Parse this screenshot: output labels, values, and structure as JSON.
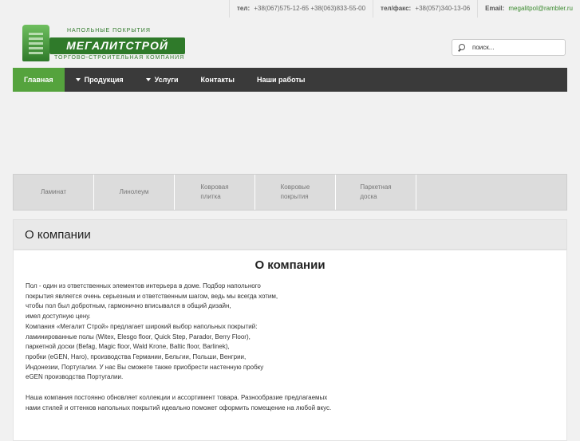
{
  "topbar": {
    "phone_label": "тел:",
    "phone_value": "+38(067)575-12-65 +38(063)833-55-00",
    "fax_label": "тел/факс:",
    "fax_value": "+38(057)340-13-06",
    "email_label": "Email:",
    "email_value": "megalitpol@rambler.ru"
  },
  "logo": {
    "top_line": "НАПОЛЬНЫЕ ПОКРЫТИЯ",
    "brand": "МЕГАЛИТСТРОЙ",
    "bottom_line": "ТОРГОВО-СТРОИТЕЛЬНАЯ КОМПАНИЯ"
  },
  "search": {
    "placeholder": "поиск..."
  },
  "nav": {
    "items": [
      {
        "label": "Главная",
        "active": true
      },
      {
        "label": "Продукция",
        "dropdown": true
      },
      {
        "label": "Услуги",
        "dropdown": true
      },
      {
        "label": "Контакты"
      },
      {
        "label": "Наши работы"
      }
    ]
  },
  "categories": [
    {
      "line1": "Ламинат",
      "line2": ""
    },
    {
      "line1": "Линолеум",
      "line2": ""
    },
    {
      "line1": "Ковровая",
      "line2": "плитка"
    },
    {
      "line1": "Ковровые",
      "line2": "покрытия"
    },
    {
      "line1": "Паркетная",
      "line2": "доска"
    }
  ],
  "page": {
    "header_title": "О компании",
    "article_title": "О компании",
    "lines_block1": [
      "Пол - один из ответственных элементов интерьера в доме. Подбор напольного",
      "покрытия является очень серьезным и ответственным шагом, ведь мы всегда хотим,",
      "чтобы пол был добротным, гармонично вписывался в общий дизайн,",
      "имел доступную цену.",
      "Компания «Мегалит Строй» предлагает широкий выбор напольных покрытий:",
      "ламинированные полы (Witex, Elesgo floor, Quick Step, Parador, Berry Floor),",
      "паркетной доски (Befag, Magic floor, Wald Krone, Baltic floor, Barlinek),",
      "пробки (eGEN, Haro), производства Германии, Бельгии, Польши, Венгрии,",
      "Индонезии, Португалии. У нас Вы сможете также приобрести настенную пробку",
      "eGEN производства Португалии."
    ],
    "lines_block2": [
      "Наша компания постоянно обновляет коллекции и ассортимент товара. Разнообразие предлагаемых",
      "нами стилей и оттенков напольных покрытий идеально поможет оформить помещение на любой вкус."
    ]
  }
}
